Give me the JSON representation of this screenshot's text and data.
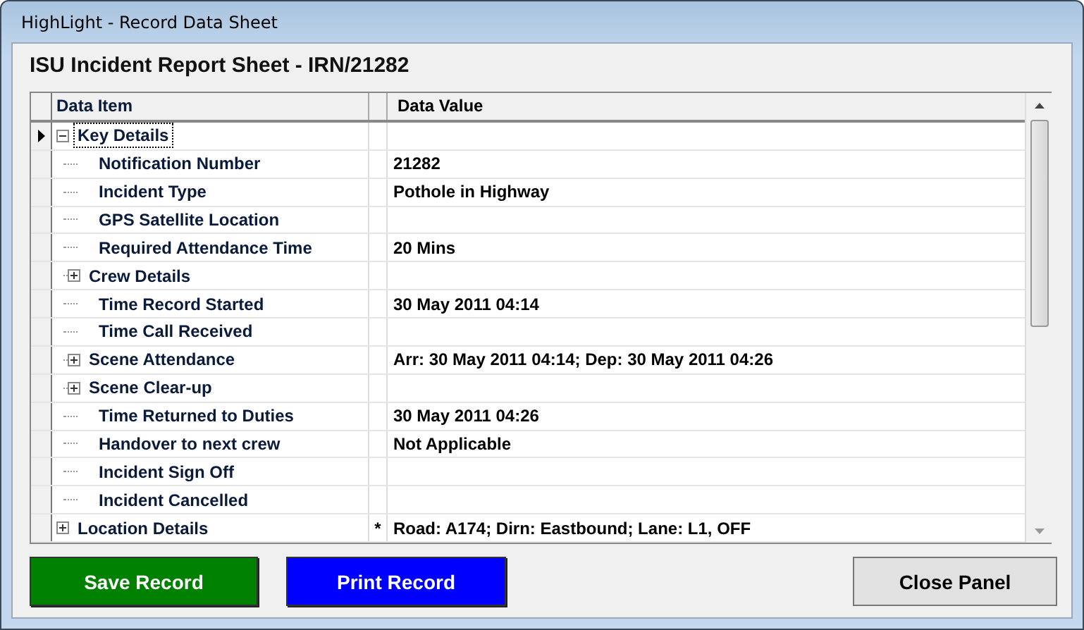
{
  "window": {
    "title": "HighLight - Record Data Sheet"
  },
  "heading": "ISU Incident Report Sheet - IRN/21282",
  "grid": {
    "columns": [
      "Data Item",
      "Data Value"
    ],
    "rows": [
      {
        "kind": "group",
        "item": "Key Details",
        "expanded": true,
        "selected": true,
        "children": [
          {
            "kind": "field",
            "item": "Notification Number",
            "value": "21282",
            "selected": false
          },
          {
            "kind": "field",
            "item": "Incident Type",
            "value": "Pothole in Highway",
            "selected": false
          },
          {
            "kind": "field",
            "item": "GPS Satellite Location",
            "selected": false
          },
          {
            "kind": "field",
            "item": "Required Attendance Time",
            "value": "20 Mins",
            "selected": false
          },
          {
            "kind": "group",
            "item": "Crew Details",
            "expanded": false,
            "selected": false
          },
          {
            "kind": "field",
            "item": "Time Record Started",
            "value": "30 May 2011 04:14",
            "selected": false
          },
          {
            "kind": "field",
            "item": "Time Call Received",
            "selected": false
          },
          {
            "kind": "group",
            "item": "Scene Attendance",
            "value": "Arr: 30 May 2011 04:14; Dep: 30 May 2011 04:26",
            "expanded": false,
            "selected": false
          },
          {
            "kind": "group",
            "item": "Scene Clear-up",
            "expanded": false,
            "selected": false
          },
          {
            "kind": "field",
            "item": "Time Returned to Duties",
            "value": "30 May 2011 04:26",
            "selected": false
          },
          {
            "kind": "field",
            "item": "Handover to next crew",
            "value": "Not Applicable",
            "selected": false
          },
          {
            "kind": "field",
            "item": "Incident Sign Off",
            "selected": false
          },
          {
            "kind": "field",
            "item": "Incident Cancelled",
            "selected": false
          }
        ]
      },
      {
        "kind": "group",
        "item": "Location Details",
        "marker": "*",
        "value": "Road: A174; Dirn: Eastbound; Lane: L1, OFF",
        "expanded": false,
        "selected": false
      }
    ]
  },
  "buttons": [
    {
      "label": "Save Record",
      "color": "#008000"
    },
    {
      "label": "Print Record",
      "color": "#0000ff"
    },
    {
      "label": "Close Panel",
      "color": "#e1e1e1"
    }
  ]
}
